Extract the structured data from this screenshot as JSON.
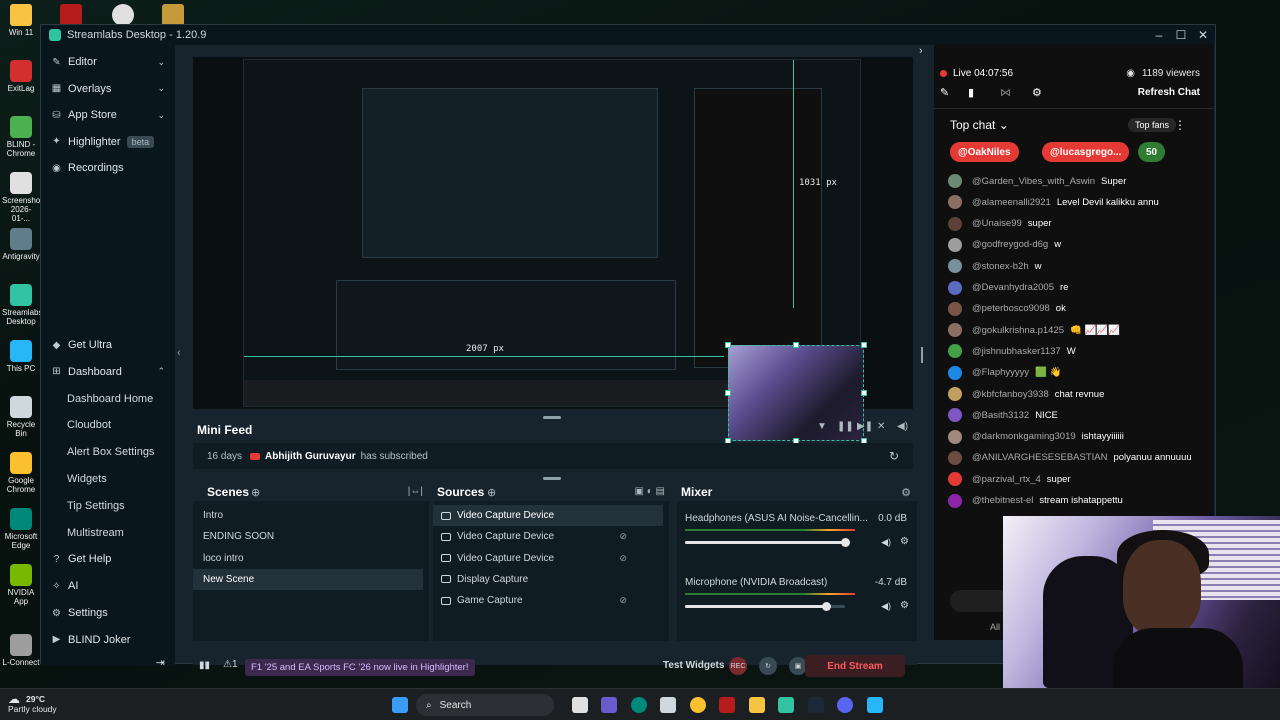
{
  "desktop": {
    "icons": [
      {
        "label": "Win 11",
        "color": "#f6c343"
      },
      {
        "label": "ExitLag",
        "color": "#d32f2f"
      },
      {
        "label": "BLIND - Chrome",
        "color": "#4caf50"
      },
      {
        "label": "Screenshot 2026-01-...",
        "color": "#e0e0e0"
      },
      {
        "label": "Antigravity",
        "color": "#607d8b"
      },
      {
        "label": "Streamlabs Desktop",
        "color": "#31c3a2"
      },
      {
        "label": "This PC",
        "color": "#29b6f6"
      },
      {
        "label": "Recycle Bin",
        "color": "#cfd8dc"
      },
      {
        "label": "Google Chrome",
        "color": "#fbc02d"
      },
      {
        "label": "Microsoft Edge",
        "color": "#00897b"
      },
      {
        "label": "NVIDIA App",
        "color": "#76b900"
      },
      {
        "label": "L-Connect",
        "color": "#9e9e9e"
      }
    ]
  },
  "window": {
    "title": "Streamlabs Desktop - 1.20.9",
    "controls": {
      "minimize": "–",
      "maximize": "☐",
      "close": "✕"
    }
  },
  "sidebar": {
    "top_items": [
      {
        "label": "Editor",
        "icon": "✎",
        "chevron": "⌄"
      },
      {
        "label": "Overlays",
        "icon": "▦",
        "chevron": "⌄"
      },
      {
        "label": "App Store",
        "icon": "⛁",
        "chevron": "⌄"
      },
      {
        "label": "Highlighter",
        "icon": "✦",
        "badge": "beta"
      },
      {
        "label": "Recordings",
        "icon": "◉"
      }
    ],
    "bottom_items": [
      {
        "label": "Get Ultra",
        "icon": "◆"
      },
      {
        "label": "Dashboard",
        "icon": "⊞",
        "chevron": "⌃"
      },
      {
        "label": "Dashboard Home",
        "sub": true
      },
      {
        "label": "Cloudbot",
        "sub": true
      },
      {
        "label": "Alert Box Settings",
        "sub": true
      },
      {
        "label": "Widgets",
        "sub": true
      },
      {
        "label": "Tip Settings",
        "sub": true
      },
      {
        "label": "Multistream",
        "sub": true
      },
      {
        "label": "Get Help",
        "icon": "?"
      },
      {
        "label": "AI",
        "icon": "✧"
      },
      {
        "label": "Settings",
        "icon": "⚙"
      },
      {
        "label": "BLIND Joker",
        "icon": "▶"
      }
    ],
    "collapse_icon": "‹",
    "logout_icon": "⇥"
  },
  "preview": {
    "width_label": "1031 px",
    "height_label": "2007 px"
  },
  "mini_feed": {
    "title": "Mini Feed",
    "event": {
      "age": "16 days",
      "user": "Abhijith Guruvayur",
      "action": "has subscribed"
    }
  },
  "scenes": {
    "title": "Scenes",
    "items": [
      "Intro",
      "ENDING SOON",
      "loco intro",
      "New Scene"
    ],
    "active_index": 3
  },
  "sources": {
    "title": "Sources",
    "items": [
      {
        "label": "Video Capture Device",
        "active": true
      },
      {
        "label": "Video Capture Device"
      },
      {
        "label": "Video Capture Device"
      },
      {
        "label": "Display Capture"
      },
      {
        "label": "Game Capture"
      }
    ]
  },
  "mixer": {
    "title": "Mixer",
    "channels": [
      {
        "name": "Headphones (ASUS AI Noise-Cancellin...",
        "db": "0.0 dB",
        "level": 1.0
      },
      {
        "name": "Microphone (NVIDIA Broadcast)",
        "db": "-4.7 dB",
        "level": 0.88
      }
    ]
  },
  "footer": {
    "promo": "F1 '25 and EA Sports FC '26 now live in Highlighter!",
    "test_widgets": "Test Widgets",
    "rec_label": "REC",
    "end_stream": "End Stream"
  },
  "chat": {
    "live_time": "Live 04:07:56",
    "viewers": "1189 viewers",
    "refresh": "Refresh Chat",
    "top_chat": "Top chat",
    "top_fans": "Top fans",
    "pinned": [
      {
        "label": "@OakNiles",
        "color": "#e53935"
      },
      {
        "label": "@lucasgrego...",
        "color": "#e53935"
      },
      {
        "label": "50",
        "color": "#2e7d32"
      }
    ],
    "messages": [
      {
        "user": "@Garden_Vibes_with_Aswin",
        "text": "Super",
        "color": "#6d8b74"
      },
      {
        "user": "@alameenalli2921",
        "text": "Level Devil kalikku annu",
        "color": "#8d6e63"
      },
      {
        "user": "@Unaise99",
        "text": "super",
        "color": "#5d4037"
      },
      {
        "user": "@godfreygod-d6g",
        "text": "w",
        "color": "#9e9e9e"
      },
      {
        "user": "@stonex-b2h",
        "text": "w",
        "color": "#78909c"
      },
      {
        "user": "@Devanhydra2005",
        "text": "re",
        "color": "#5c6bc0"
      },
      {
        "user": "@peterbosco9098",
        "text": "ok",
        "color": "#795548"
      },
      {
        "user": "@gokulkrishna.p1425",
        "text": "👊 📈📈📈",
        "color": "#8d6e63"
      },
      {
        "user": "@jishnubhasker1137",
        "text": "W",
        "color": "#43a047"
      },
      {
        "user": "@Flaphyyyyy",
        "text": "🟩 👋",
        "color": "#1e88e5"
      },
      {
        "user": "@kbfcfanboy3938",
        "text": "chat revnue",
        "color": "#c0a060"
      },
      {
        "user": "@Basith3132",
        "text": "NICE",
        "color": "#7e57c2"
      },
      {
        "user": "@darkmonkgaming3019",
        "text": "ishtayyiiiiii",
        "color": "#a1887f"
      },
      {
        "user": "@ANILVARGHESESEBASTIAN",
        "text": "polyanuu annuuuu",
        "color": "#6d4c41"
      },
      {
        "user": "@parzival_rtx_4",
        "text": "super",
        "color": "#e53935"
      },
      {
        "user": "@thebitnest-el",
        "text": "stream ishatappettu",
        "color": "#8e24aa"
      }
    ]
  },
  "taskbar": {
    "weather_temp": "29°C",
    "weather_desc": "Partly cloudy",
    "search": "Search"
  }
}
